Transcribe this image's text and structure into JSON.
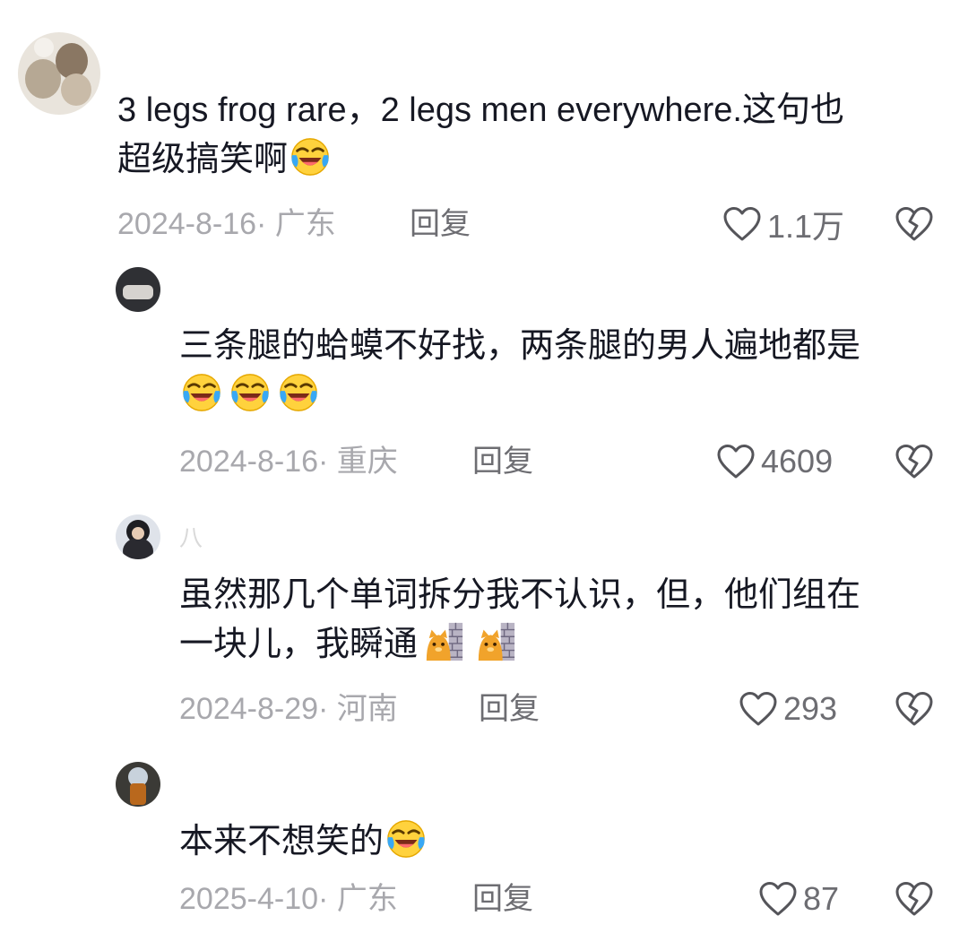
{
  "comments": [
    {
      "text": "3 legs frog rare，2 legs men everywhere.这句也\n超级搞笑啊",
      "emojis": [
        "cry-laugh-icon"
      ],
      "date": "2024-8-16",
      "location": "广东",
      "reply_label": "回复",
      "likes": "1.1万"
    },
    {
      "username": "",
      "text": "三条腿的蛤蟆不好找，两条腿的男人遍地都是\n",
      "emojis": [
        "cry-laugh-icon",
        "cry-laugh-icon",
        "cry-laugh-icon"
      ],
      "date": "2024-8-16",
      "location": "重庆",
      "reply_label": "回复",
      "likes": "4609"
    },
    {
      "username": "八",
      "text": "虽然那几个单词拆分我不认识，但，他们组在\n一块儿，我瞬通",
      "emojis": [
        "cat-peeking-wall-icon",
        "cat-peeking-wall-icon"
      ],
      "date": "2024-8-29",
      "location": "河南",
      "reply_label": "回复",
      "likes": "293"
    },
    {
      "username": "",
      "text": "本来不想笑的",
      "emojis": [
        "cry-laugh-icon"
      ],
      "date": "2025-4-10",
      "location": "广东",
      "reply_label": "回复",
      "likes": "87"
    }
  ],
  "colors": {
    "text": "#161823",
    "meta": "#a8a8ad",
    "action": "#6d6d72"
  }
}
